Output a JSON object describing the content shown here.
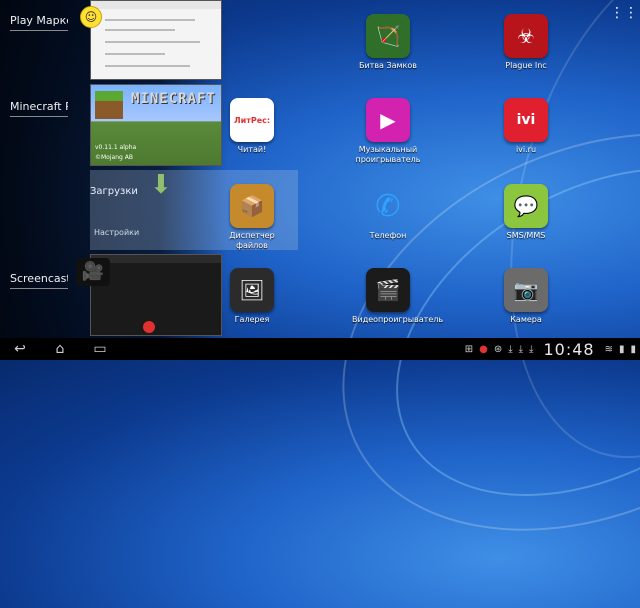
{
  "recent_apps": [
    {
      "label": "Play Марке"
    },
    {
      "label": "Minecraft PE"
    },
    {
      "label": "Screencast"
    }
  ],
  "minecraft_thumb": {
    "title": "MINECRAFT",
    "version": "v0.11.1 alpha",
    "copyright": "©Mojang AB"
  },
  "downloads_thumb": {
    "title": "Загрузки",
    "settings_label": "Настройки"
  },
  "apps": [
    {
      "label": "Битва Замков",
      "icon": "castle-battle-icon",
      "color": "#2f6f2a"
    },
    {
      "label": "Plague Inc",
      "icon": "biohazard-icon",
      "color": "#b8141c"
    },
    {
      "label": "Читай!",
      "icon": "litres-icon",
      "color": "#ffffff"
    },
    {
      "label": "Музыкальный проигрыватель",
      "icon": "music-player-icon",
      "color": "#d321b0"
    },
    {
      "label": "ivi.ru",
      "icon": "ivi-icon",
      "color": "#e0202e"
    },
    {
      "label": "Диспетчер файлов",
      "icon": "file-manager-icon",
      "color": "#c58a2b"
    },
    {
      "label": "Телефон",
      "icon": "phone-icon",
      "color": "#2ea4ff"
    },
    {
      "label": "SMS/MMS",
      "icon": "sms-icon",
      "color": "#8cc63f"
    },
    {
      "label": "Галерея",
      "icon": "gallery-icon",
      "color": "#2b2b2b"
    },
    {
      "label": "Видеопроигрыватель",
      "icon": "video-player-icon",
      "color": "#1b1b1b"
    },
    {
      "label": "Камера",
      "icon": "camera-icon",
      "color": "#6b6b6b"
    }
  ],
  "litres_text": "ЛитРес:",
  "ivi_text": "ivi",
  "status": {
    "time": "10:48"
  }
}
